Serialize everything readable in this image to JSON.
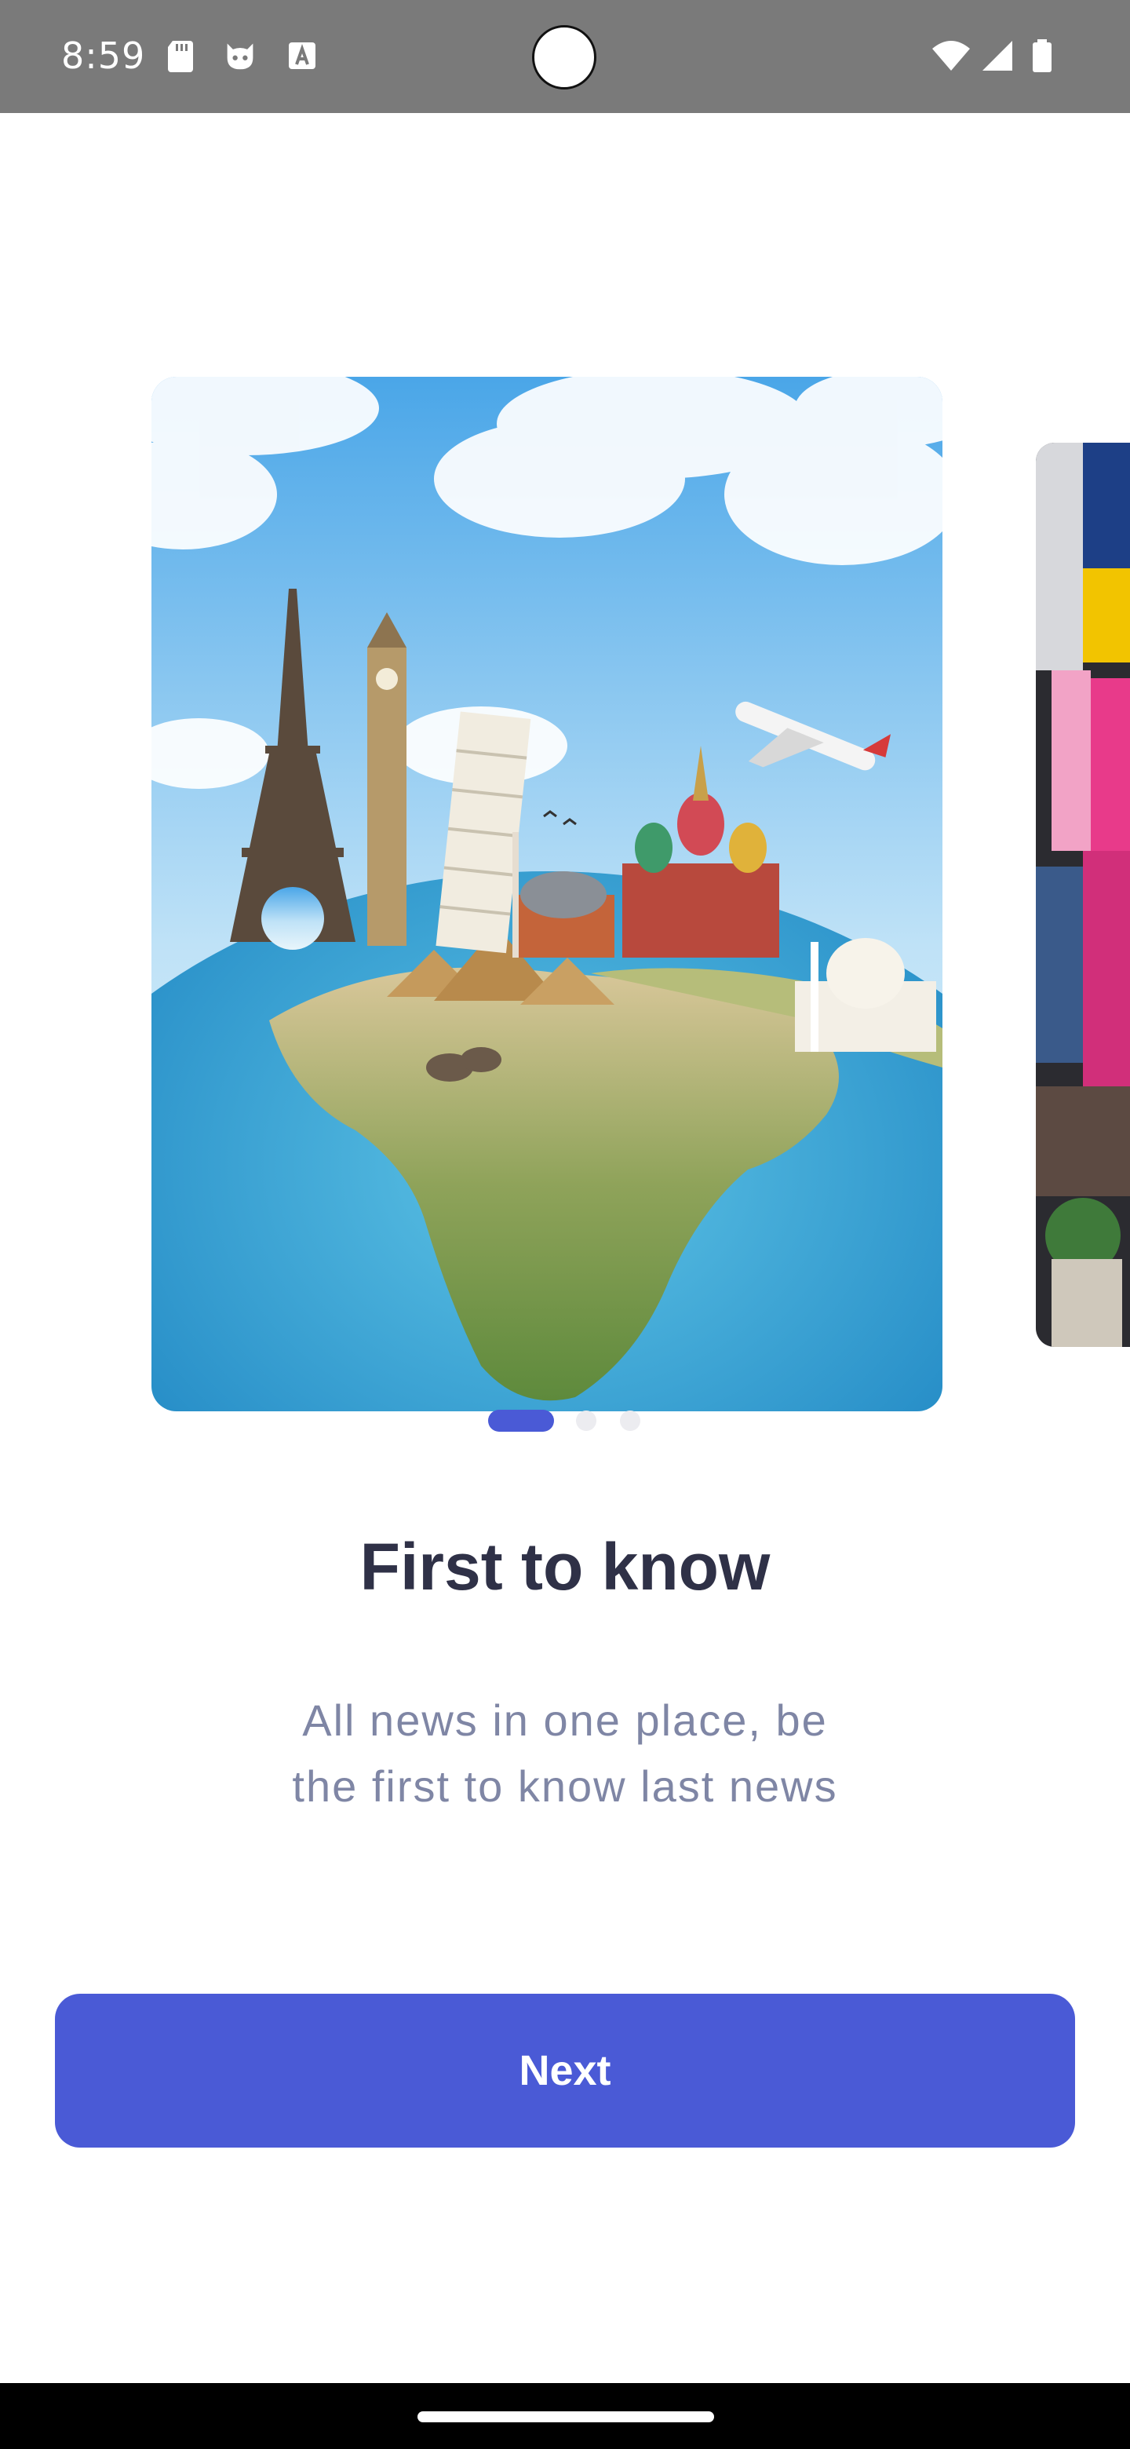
{
  "status_bar": {
    "time": "8:59",
    "left_icons": [
      "sd-card-icon",
      "cat-face-icon",
      "font-a-icon"
    ],
    "right_icons": [
      "wifi-icon",
      "cell-signal-icon",
      "battery-icon"
    ]
  },
  "carousel": {
    "slides": [
      {
        "image": "world-landmarks-globe-image"
      },
      {
        "image": "times-square-street-image"
      }
    ],
    "active_index": 0,
    "count": 3
  },
  "onboarding": {
    "title": "First to know",
    "description_line1": "All news in one place, be",
    "description_line2": "the first to know last news"
  },
  "actions": {
    "next_label": "Next"
  },
  "colors": {
    "primary": "#4a5ad6",
    "title": "#2f3147",
    "subtitle": "#7f86a5",
    "status_bar": "#7a7a7a",
    "inactive_dot": "#ececf0"
  }
}
